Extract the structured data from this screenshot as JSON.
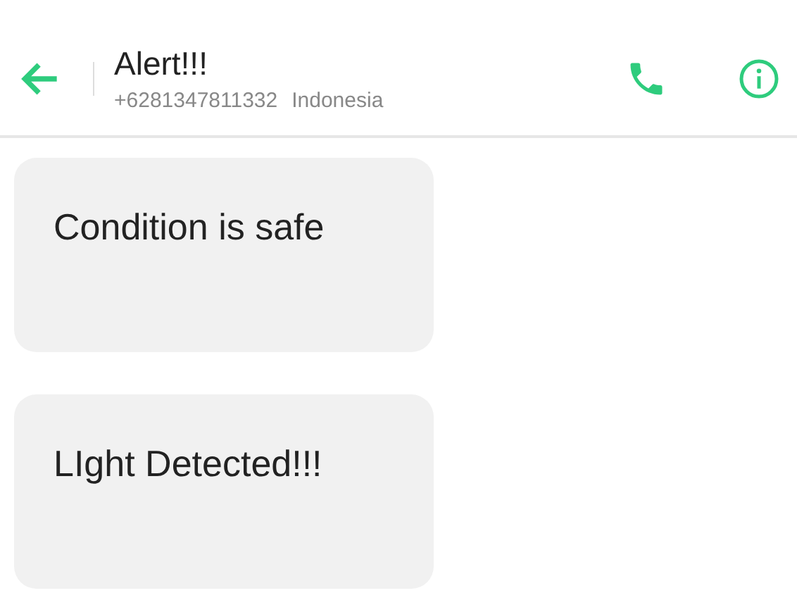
{
  "header": {
    "title": "Alert!!!",
    "phone": "+6281347811332",
    "country": "Indonesia"
  },
  "messages": [
    {
      "text": "Condition is safe"
    },
    {
      "text": "LIght Detected!!!"
    }
  ]
}
